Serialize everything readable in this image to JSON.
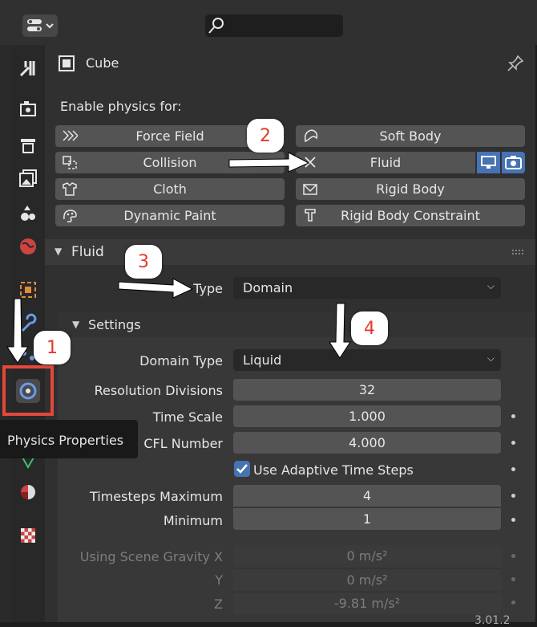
{
  "header": {
    "object_name": "Cube",
    "enable_physics_label": "Enable physics for:"
  },
  "physics_buttons": [
    {
      "label": "Force Field"
    },
    {
      "label": "Soft Body"
    },
    {
      "label": "Collision"
    },
    {
      "label": "Fluid"
    },
    {
      "label": "Cloth"
    },
    {
      "label": "Rigid Body"
    },
    {
      "label": "Dynamic Paint"
    },
    {
      "label": "Rigid Body Constraint"
    }
  ],
  "fluid": {
    "panel_title": "Fluid",
    "type_label": "Type",
    "type_value": "Domain",
    "settings_title": "Settings",
    "domain_type_label": "Domain Type",
    "domain_type_value": "Liquid",
    "resolution_label": "Resolution Divisions",
    "resolution_value": "32",
    "time_scale_label": "Time Scale",
    "time_scale_value": "1.000",
    "cfl_label": "CFL Number",
    "cfl_value": "4.000",
    "adaptive_label": "Use Adaptive Time Steps",
    "adaptive_checked": true,
    "timesteps_max_label": "Timesteps Maximum",
    "timesteps_max_value": "4",
    "minimum_label": "Minimum",
    "minimum_value": "1",
    "gravity_x_label": "Using Scene Gravity X",
    "gravity_x_value": "0 m/s²",
    "gravity_y_label": "Y",
    "gravity_y_value": "0 m/s²",
    "gravity_z_label": "Z",
    "gravity_z_value": "-9.81 m/s²"
  },
  "tooltip": {
    "text": "Physics Properties"
  },
  "callouts": [
    "1",
    "2",
    "3",
    "4"
  ],
  "version": "3.01.2",
  "colors": {
    "highlight_box": "#e4473b",
    "accent_blue": "#4772b3",
    "panel_bg": "#303030"
  }
}
